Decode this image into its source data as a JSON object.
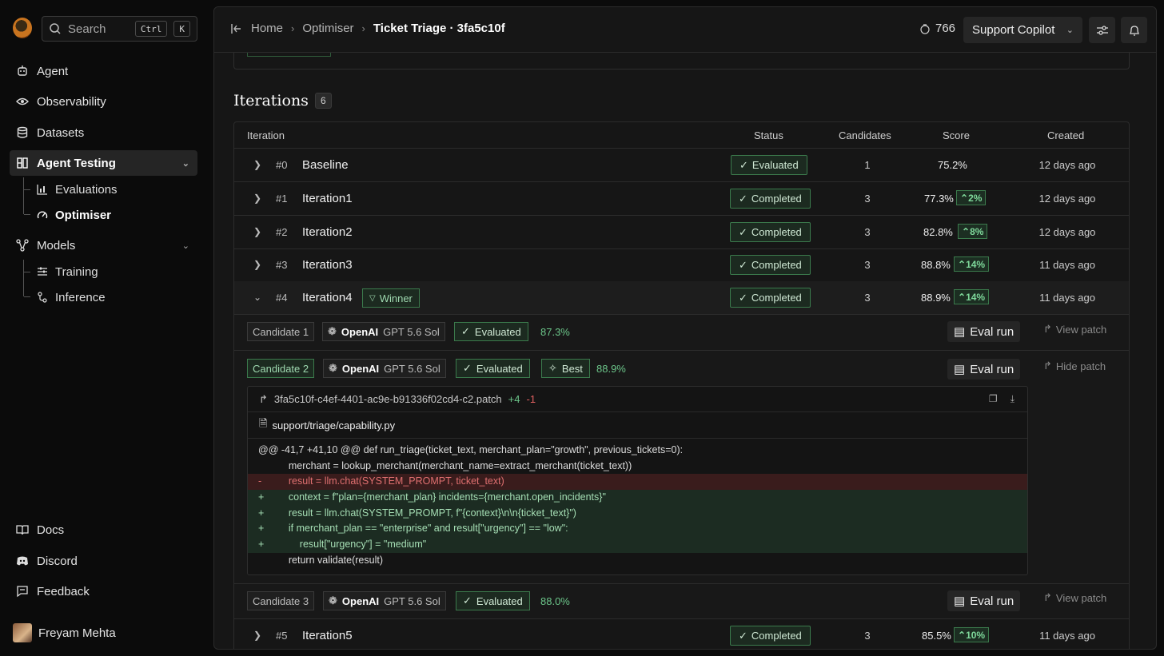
{
  "sidebar": {
    "search_label": "Search",
    "search_kbd": [
      "Ctrl",
      "K"
    ],
    "items": [
      {
        "label": "Agent",
        "icon": "bot-icon"
      },
      {
        "label": "Observability",
        "icon": "eye-icon"
      },
      {
        "label": "Datasets",
        "icon": "database-icon"
      },
      {
        "label": "Agent Testing",
        "icon": "testing-icon",
        "expanded": true,
        "children": [
          {
            "label": "Evaluations",
            "icon": "chart-icon"
          },
          {
            "label": "Optimiser",
            "icon": "gauge-icon",
            "active": true
          }
        ]
      },
      {
        "label": "Models",
        "icon": "models-icon",
        "children": [
          {
            "label": "Training",
            "icon": "sliders-icon"
          },
          {
            "label": "Inference",
            "icon": "inference-icon"
          }
        ]
      }
    ],
    "footer": [
      {
        "label": "Docs",
        "icon": "book-icon"
      },
      {
        "label": "Discord",
        "icon": "discord-icon"
      },
      {
        "label": "Feedback",
        "icon": "chat-icon"
      }
    ],
    "user_name": "Freyam Mehta"
  },
  "header": {
    "breadcrumb": [
      "Home",
      "Optimiser",
      "Ticket Triage · 3fa5c10f"
    ],
    "credits": "766",
    "project": "Support Copilot"
  },
  "iterations": {
    "title": "Iterations",
    "count": "6",
    "columns": [
      "Iteration",
      "Status",
      "Candidates",
      "Score",
      "Created"
    ],
    "rows": [
      {
        "num": "#0",
        "name": "Baseline",
        "status": "Evaluated",
        "candidates": "1",
        "score": "75.2%",
        "delta": "",
        "created": "12 days ago"
      },
      {
        "num": "#1",
        "name": "Iteration1",
        "status": "Completed",
        "candidates": "3",
        "score": "77.3%",
        "delta": "2%",
        "created": "12 days ago"
      },
      {
        "num": "#2",
        "name": "Iteration2",
        "status": "Completed",
        "candidates": "3",
        "score": "82.8%",
        "delta": "8%",
        "created": "12 days ago"
      },
      {
        "num": "#3",
        "name": "Iteration3",
        "status": "Completed",
        "candidates": "3",
        "score": "88.8%",
        "delta": "14%",
        "created": "11 days ago"
      },
      {
        "num": "#4",
        "name": "Iteration4",
        "badge": "Winner",
        "status": "Completed",
        "candidates": "3",
        "score": "88.9%",
        "delta": "14%",
        "created": "11 days ago"
      },
      {
        "num": "#5",
        "name": "Iteration5",
        "status": "Completed",
        "candidates": "3",
        "score": "85.5%",
        "delta": "10%",
        "created": "11 days ago"
      }
    ]
  },
  "candidates": [
    {
      "label": "Candidate 1",
      "provider": "OpenAI",
      "model": "GPT 5.6 Sol",
      "status": "Evaluated",
      "score": "87.3%",
      "eval_run": "Eval run",
      "patch_link": "View patch"
    },
    {
      "label": "Candidate 2",
      "provider": "OpenAI",
      "model": "GPT 5.6 Sol",
      "status": "Evaluated",
      "best": "Best",
      "score": "88.9%",
      "eval_run": "Eval run",
      "patch_link": "Hide patch"
    },
    {
      "label": "Candidate 3",
      "provider": "OpenAI",
      "model": "GPT 5.6 Sol",
      "status": "Evaluated",
      "score": "88.0%",
      "eval_run": "Eval run",
      "patch_link": "View patch"
    }
  ],
  "patch": {
    "filename": "3fa5c10f-c4ef-4401-ac9e-b91336f02cd4-c2.patch",
    "additions": "+4",
    "deletions": "-1",
    "file_path": "support/triage/capability.py",
    "lines": [
      {
        "type": "hunk",
        "mark": "",
        "text": "@@ -41,7 +41,10 @@ def run_triage(ticket_text, merchant_plan=\"growth\", previous_tickets=0):"
      },
      {
        "type": "ctx",
        "mark": "",
        "text": "    merchant = lookup_merchant(merchant_name=extract_merchant(ticket_text))"
      },
      {
        "type": "del",
        "mark": "-",
        "text": "    result = llm.chat(SYSTEM_PROMPT, ticket_text)"
      },
      {
        "type": "add",
        "mark": "+",
        "text": "    context = f\"plan={merchant_plan} incidents={merchant.open_incidents}\""
      },
      {
        "type": "add",
        "mark": "+",
        "text": "    result = llm.chat(SYSTEM_PROMPT, f\"{context}\\n\\n{ticket_text}\")"
      },
      {
        "type": "add",
        "mark": "+",
        "text": "    if merchant_plan == \"enterprise\" and result[\"urgency\"] == \"low\":"
      },
      {
        "type": "add",
        "mark": "+",
        "text": "        result[\"urgency\"] = \"medium\""
      },
      {
        "type": "ctx",
        "mark": "",
        "text": "    return validate(result)"
      }
    ]
  },
  "colors": {
    "accent_green": "#3b7a4c",
    "diff_add": "#1c2c22",
    "diff_del": "#3a1c1c"
  }
}
